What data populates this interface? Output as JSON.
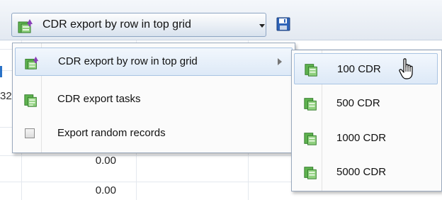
{
  "toolbar": {
    "dropdown_label": "CDR export by row in top grid",
    "dropdown_icon": "export-icon",
    "save_icon": "save-icon"
  },
  "grid": {
    "cut_label": "32",
    "values": [
      "0.00",
      "0.00"
    ]
  },
  "menu": {
    "items": [
      {
        "label": "CDR export by row in top grid",
        "icon": "export-icon",
        "has_submenu": true
      },
      {
        "label": "CDR export tasks",
        "icon": "export-tasks-icon"
      },
      {
        "label": "Export random records",
        "icon": "checkbox",
        "checked": false
      }
    ]
  },
  "submenu": {
    "items": [
      {
        "label": "100 CDR",
        "icon": "export-icon"
      },
      {
        "label": "500 CDR",
        "icon": "export-icon"
      },
      {
        "label": "1000 CDR",
        "icon": "export-icon"
      },
      {
        "label": "5000 CDR",
        "icon": "export-icon"
      }
    ]
  },
  "colors": {
    "accent": "#a9c4e3",
    "icon_green": "#5fb24f",
    "icon_purple": "#8a3fb8",
    "save_blue": "#2e63b8"
  }
}
